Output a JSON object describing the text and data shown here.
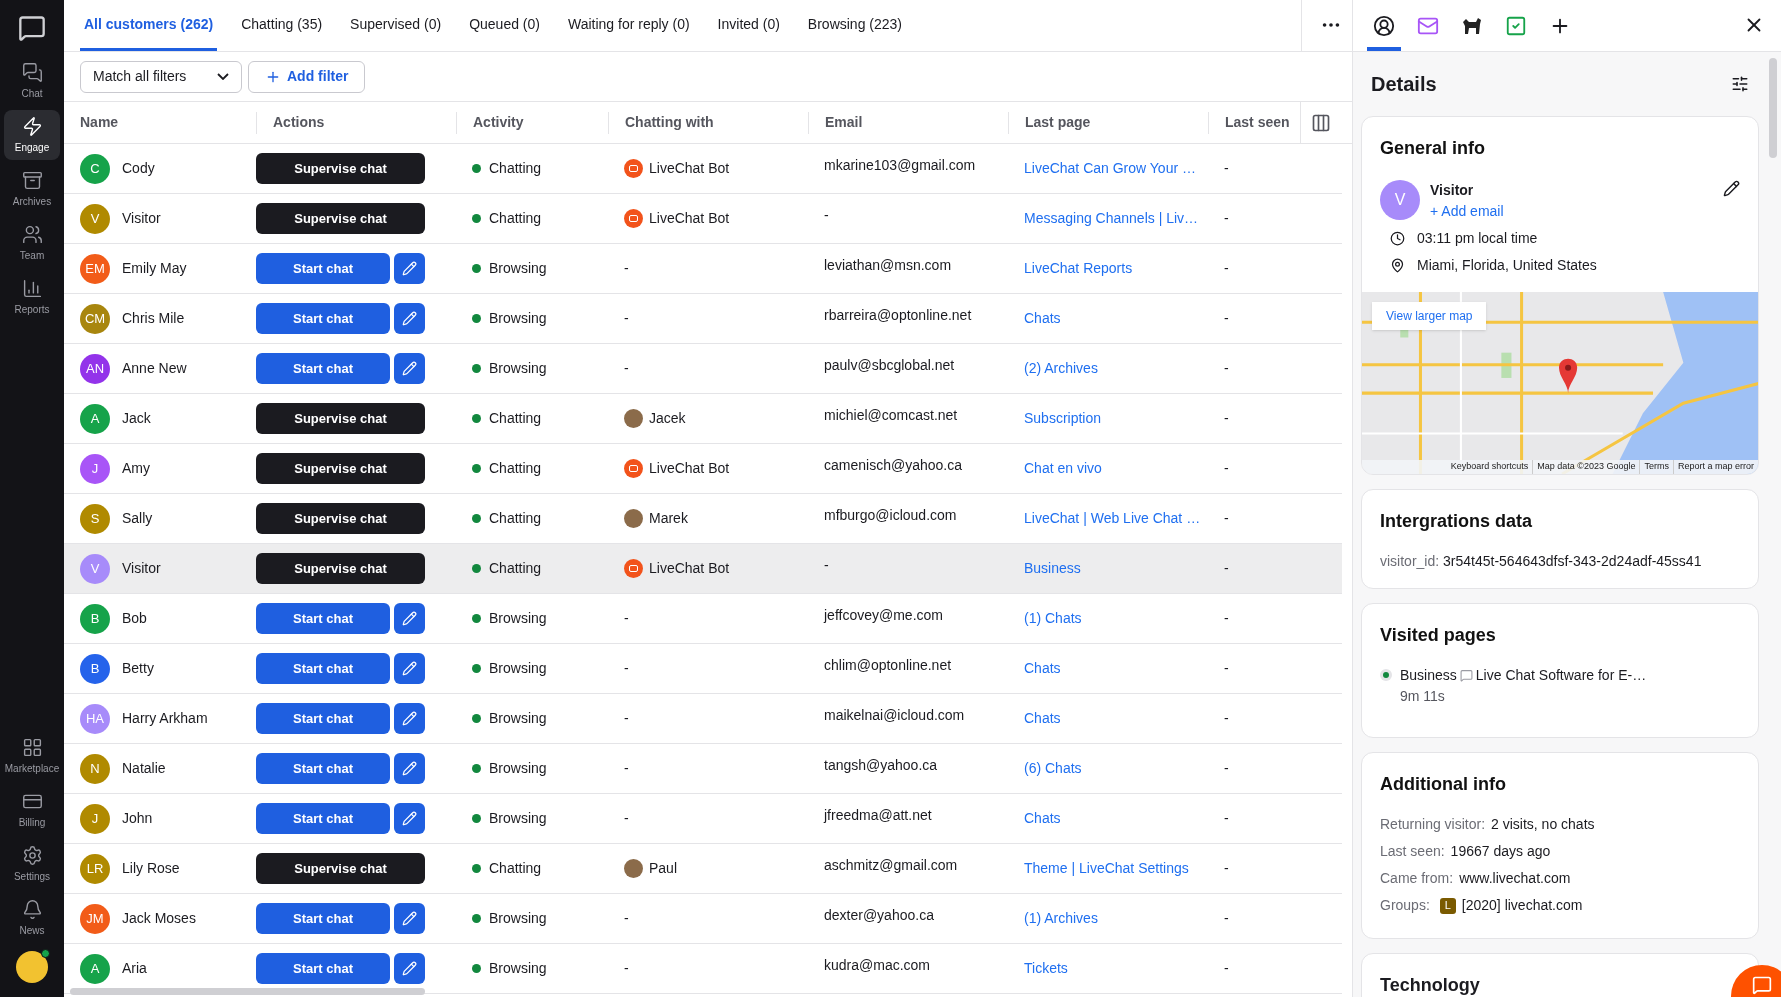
{
  "sidebar": {
    "top": [
      {
        "label": "Chat",
        "selected": false
      },
      {
        "label": "Engage",
        "selected": true
      },
      {
        "label": "Archives",
        "selected": false
      },
      {
        "label": "Team",
        "selected": false
      },
      {
        "label": "Reports",
        "selected": false
      }
    ],
    "bottom": [
      {
        "label": "Marketplace"
      },
      {
        "label": "Billing"
      },
      {
        "label": "Settings"
      },
      {
        "label": "News"
      }
    ]
  },
  "tabs": [
    {
      "label": "All customers (262)",
      "selected": true
    },
    {
      "label": "Chatting (35)",
      "selected": false
    },
    {
      "label": "Supervised (0)",
      "selected": false
    },
    {
      "label": "Queued (0)",
      "selected": false
    },
    {
      "label": "Waiting for reply (0)",
      "selected": false
    },
    {
      "label": "Invited (0)",
      "selected": false
    },
    {
      "label": "Browsing (223)",
      "selected": false
    }
  ],
  "filters": {
    "match": "Match all filters",
    "add": "Add filter"
  },
  "table": {
    "columns": [
      "Name",
      "Actions",
      "Activity",
      "Chatting with",
      "Email",
      "Last page",
      "Last seen"
    ],
    "rows": [
      {
        "initials": "C",
        "color": "#16a34a",
        "name": "Cody",
        "action": "Supervise chat",
        "kind": "supervise",
        "activity": "Chatting",
        "agent": {
          "name": "LiveChat Bot",
          "kind": "bot"
        },
        "email": "mkarine103@gmail.com",
        "last_page": "LiveChat Can Grow Your …",
        "last_seen": "-",
        "selected": false
      },
      {
        "initials": "V",
        "color": "#b08a00",
        "name": "Visitor",
        "action": "Supervise chat",
        "kind": "supervise",
        "activity": "Chatting",
        "agent": {
          "name": "LiveChat Bot",
          "kind": "bot"
        },
        "email": "-",
        "last_page": "Messaging Channels | Liv…",
        "last_seen": "-",
        "selected": false
      },
      {
        "initials": "EM",
        "color": "#f25c19",
        "name": "Emily May",
        "action": "Start chat",
        "kind": "start",
        "activity": "Browsing",
        "agent": {
          "name": "-",
          "kind": "none"
        },
        "email": "leviathan@msn.com",
        "last_page": "LiveChat Reports",
        "last_seen": "-",
        "selected": false
      },
      {
        "initials": "CM",
        "color": "#a8860e",
        "name": "Chris Mile",
        "action": "Start chat",
        "kind": "start",
        "activity": "Browsing",
        "agent": {
          "name": "-",
          "kind": "none"
        },
        "email": "rbarreira@optonline.net",
        "last_page": "Chats",
        "last_seen": "-",
        "selected": false
      },
      {
        "initials": "AN",
        "color": "#9333ea",
        "name": "Anne New",
        "action": "Start chat",
        "kind": "start",
        "activity": "Browsing",
        "agent": {
          "name": "-",
          "kind": "none"
        },
        "email": "paulv@sbcglobal.net",
        "last_page": "(2) Archives",
        "last_seen": "-",
        "selected": false
      },
      {
        "initials": "A",
        "color": "#16a34a",
        "name": "Jack",
        "action": "Supervise chat",
        "kind": "supervise",
        "activity": "Chatting",
        "agent": {
          "name": "Jacek",
          "kind": "person"
        },
        "email": "michiel@comcast.net",
        "last_page": "Subscription",
        "last_seen": "-",
        "selected": false
      },
      {
        "initials": "J",
        "color": "#a855f7",
        "name": "Amy",
        "action": "Supervise chat",
        "kind": "supervise",
        "activity": "Chatting",
        "agent": {
          "name": "LiveChat Bot",
          "kind": "bot"
        },
        "email": "camenisch@yahoo.ca",
        "last_page": "Chat en vivo",
        "last_seen": "-",
        "selected": false
      },
      {
        "initials": "S",
        "color": "#b08a00",
        "name": "Sally",
        "action": "Supervise chat",
        "kind": "supervise",
        "activity": "Chatting",
        "agent": {
          "name": "Marek",
          "kind": "person"
        },
        "email": "mfburgo@icloud.com",
        "last_page": "LiveChat | Web Live Chat …",
        "last_seen": "-",
        "selected": false
      },
      {
        "initials": "V",
        "color": "#a78bfa",
        "name": "Visitor",
        "action": "Supervise chat",
        "kind": "supervise",
        "activity": "Chatting",
        "agent": {
          "name": "LiveChat Bot",
          "kind": "bot"
        },
        "email": "-",
        "last_page": "Business",
        "last_seen": "-",
        "selected": true
      },
      {
        "initials": "B",
        "color": "#16a34a",
        "name": "Bob",
        "action": "Start chat",
        "kind": "start",
        "activity": "Browsing",
        "agent": {
          "name": "-",
          "kind": "none"
        },
        "email": "jeffcovey@me.com",
        "last_page": "(1) Chats",
        "last_seen": "-",
        "selected": false
      },
      {
        "initials": "B",
        "color": "#2563eb",
        "name": "Betty",
        "action": "Start chat",
        "kind": "start",
        "activity": "Browsing",
        "agent": {
          "name": "-",
          "kind": "none"
        },
        "email": "chlim@optonline.net",
        "last_page": "Chats",
        "last_seen": "-",
        "selected": false
      },
      {
        "initials": "HA",
        "color": "#a78bfa",
        "name": "Harry Arkham",
        "action": "Start chat",
        "kind": "start",
        "activity": "Browsing",
        "agent": {
          "name": "-",
          "kind": "none"
        },
        "email": "maikelnai@icloud.com",
        "last_page": "Chats",
        "last_seen": "-",
        "selected": false
      },
      {
        "initials": "N",
        "color": "#b08a00",
        "name": "Natalie",
        "action": "Start chat",
        "kind": "start",
        "activity": "Browsing",
        "agent": {
          "name": "-",
          "kind": "none"
        },
        "email": "tangsh@yahoo.ca",
        "last_page": "(6) Chats",
        "last_seen": "-",
        "selected": false
      },
      {
        "initials": "J",
        "color": "#b08a00",
        "name": "John",
        "action": "Start chat",
        "kind": "start",
        "activity": "Browsing",
        "agent": {
          "name": "-",
          "kind": "none"
        },
        "email": "jfreedma@att.net",
        "last_page": "Chats",
        "last_seen": "-",
        "selected": false
      },
      {
        "initials": "LR",
        "color": "#b08a00",
        "name": "Lily Rose",
        "action": "Supervise chat",
        "kind": "supervise",
        "activity": "Chatting",
        "agent": {
          "name": "Paul",
          "kind": "person"
        },
        "email": "aschmitz@gmail.com",
        "last_page": "Theme | LiveChat Settings",
        "last_seen": "-",
        "selected": false
      },
      {
        "initials": "JM",
        "color": "#f25c19",
        "name": "Jack Moses",
        "action": "Start chat",
        "kind": "start",
        "activity": "Browsing",
        "agent": {
          "name": "-",
          "kind": "none"
        },
        "email": "dexter@yahoo.ca",
        "last_page": "(1) Archives",
        "last_seen": "-",
        "selected": false
      },
      {
        "initials": "A",
        "color": "#16a34a",
        "name": "Aria",
        "action": "Start chat",
        "kind": "start",
        "activity": "Browsing",
        "agent": {
          "name": "-",
          "kind": "none"
        },
        "email": "kudra@mac.com",
        "last_page": "Tickets",
        "last_seen": "-",
        "selected": false
      }
    ]
  },
  "details": {
    "tabs": [
      {
        "selected": true
      },
      {
        "selected": false
      },
      {
        "selected": false
      },
      {
        "selected": false
      },
      {
        "selected": false
      }
    ],
    "title": "Details",
    "general": {
      "title": "General info",
      "initial": "V",
      "name": "Visitor",
      "add_email": "+ Add email",
      "local_time": "03:11 pm local time",
      "location": "Miami, Florida, United States",
      "map": {
        "link": "View larger map",
        "attribution": [
          "Keyboard shortcuts",
          "Map data ©2023 Google",
          "Terms",
          "Report a map error"
        ]
      }
    },
    "integrations": {
      "title": "Intergrations data",
      "key": "visitor_id:",
      "value": "3r54t45t-564643dfsf-343-2d24adf-45ss41"
    },
    "visited": {
      "title": "Visited pages",
      "pages": [
        {
          "name": "Business",
          "title": "Live Chat Software for E-…",
          "duration": "9m 11s"
        }
      ]
    },
    "additional": {
      "title": "Additional info",
      "items": [
        {
          "key": "Returning visitor:",
          "value": "2 visits, no chats"
        },
        {
          "key": "Last seen:",
          "value": "19667 days ago"
        },
        {
          "key": "Came from:",
          "value": "www.livechat.com"
        },
        {
          "key": "Groups:",
          "badge": "L",
          "value": "[2020] livechat.com"
        }
      ]
    },
    "technology": {
      "title": "Technology"
    }
  }
}
